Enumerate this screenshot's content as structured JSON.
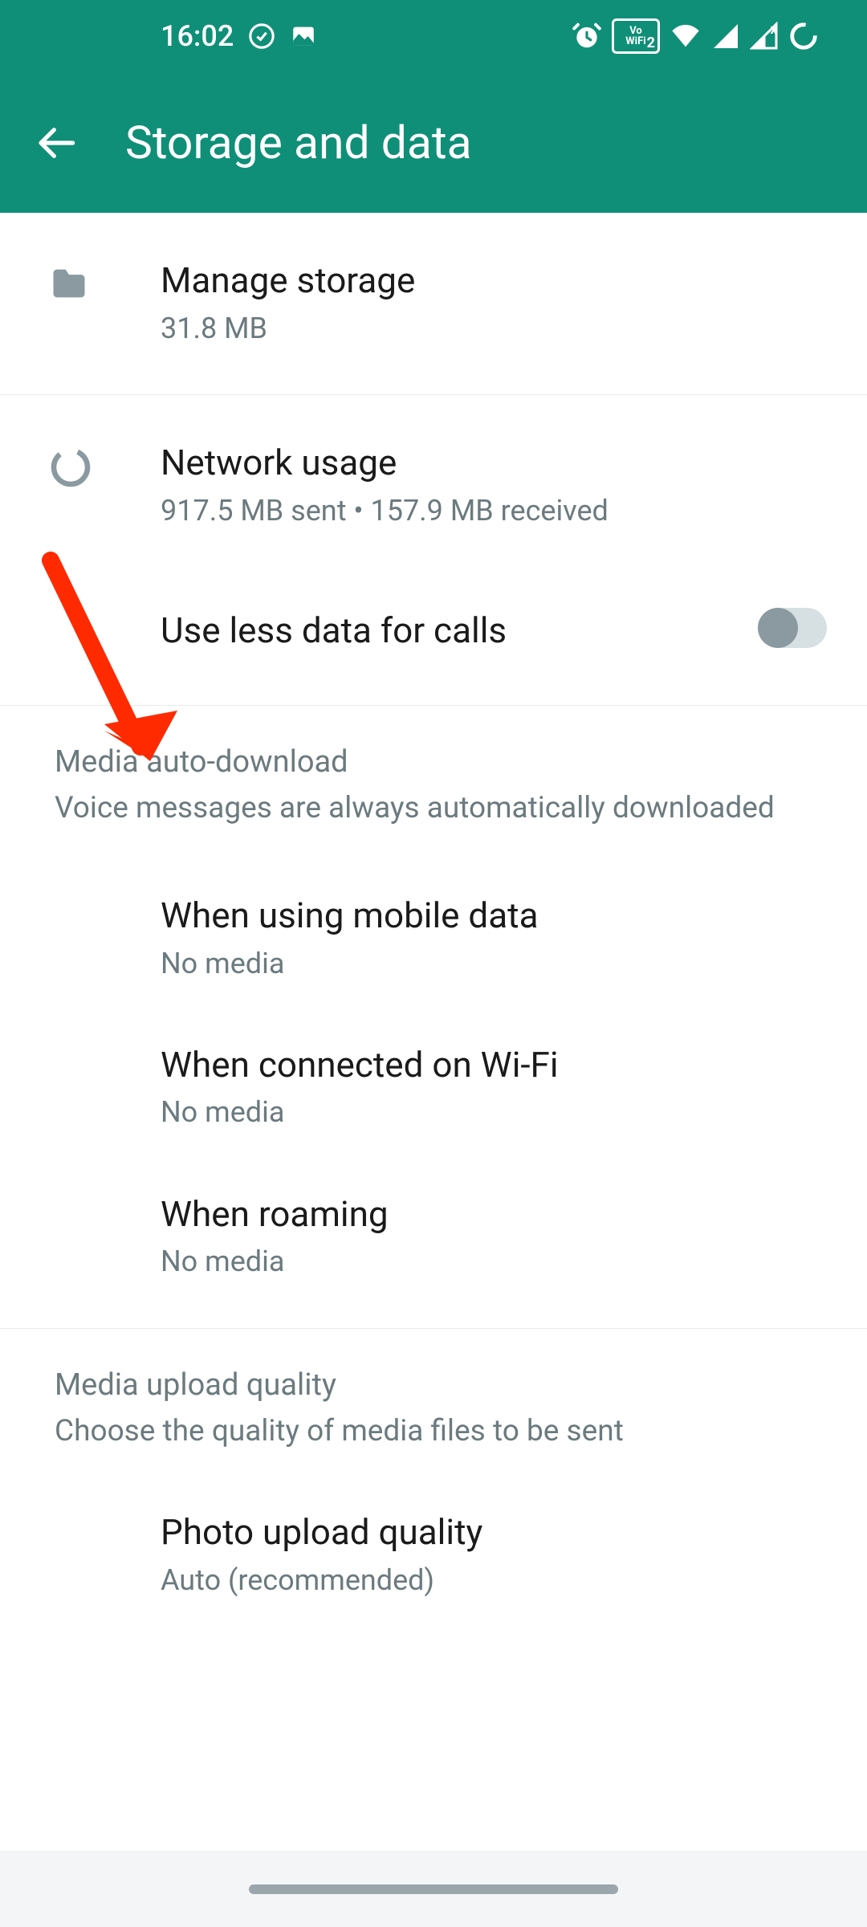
{
  "status_bar": {
    "time": "16:02"
  },
  "header": {
    "title": "Storage and data"
  },
  "rows": {
    "manage_storage": {
      "title": "Manage storage",
      "subtitle": "31.8 MB"
    },
    "network_usage": {
      "title": "Network usage",
      "subtitle": "917.5 MB sent • 157.9 MB received"
    },
    "use_less_data": {
      "title": "Use less data for calls",
      "toggle_on": false
    }
  },
  "sections": {
    "media_auto_download": {
      "title": "Media auto-download",
      "desc": "Voice messages are always automatically downloaded",
      "items": [
        {
          "title": "When using mobile data",
          "subtitle": "No media"
        },
        {
          "title": "When connected on Wi-Fi",
          "subtitle": "No media"
        },
        {
          "title": "When roaming",
          "subtitle": "No media"
        }
      ]
    },
    "media_upload_quality": {
      "title": "Media upload quality",
      "desc": "Choose the quality of media files to be sent",
      "items": [
        {
          "title": "Photo upload quality",
          "subtitle": "Auto (recommended)"
        }
      ]
    }
  },
  "colors": {
    "accent": "#0f8f78",
    "text_primary": "#1a1a1a",
    "text_secondary": "#6b7a7e"
  },
  "annotation": {
    "arrow_color": "#ff2a00"
  }
}
